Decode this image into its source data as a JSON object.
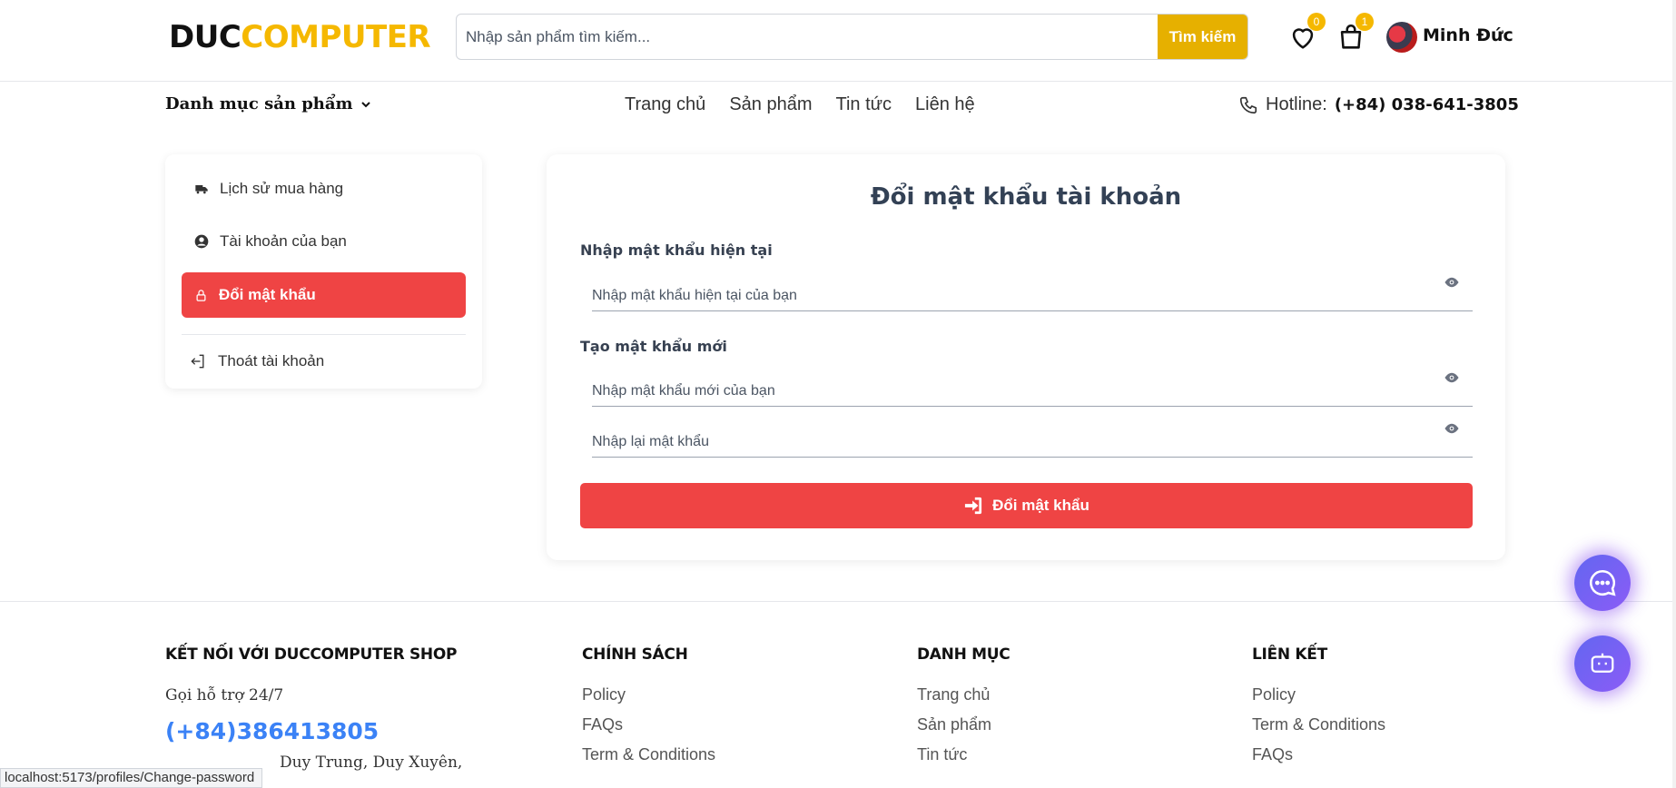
{
  "header": {
    "logo_part1": "DUC",
    "logo_part2": "COMPUTER",
    "search_placeholder": "Nhập sản phẩm tìm kiếm...",
    "search_button": "Tìm kiếm",
    "wishlist_count": "0",
    "cart_count": "1",
    "username": "Minh Đức"
  },
  "nav": {
    "category_menu": "Danh mục sản phẩm",
    "links": [
      "Trang chủ",
      "Sản phẩm",
      "Tin tức",
      "Liên hệ"
    ],
    "hotline_label": "Hotline:",
    "hotline_number": "(+84) 038-641-3805"
  },
  "sidebar": {
    "items": [
      {
        "label": "Lịch sử mua hàng",
        "icon": "truck-icon"
      },
      {
        "label": "Tài khoản của bạn",
        "icon": "user-circle-icon"
      },
      {
        "label": "Đổi mật khẩu",
        "icon": "lock-icon"
      },
      {
        "label": "Thoát tài khoản",
        "icon": "logout-icon"
      }
    ]
  },
  "form": {
    "title": "Đổi mật khẩu tài khoản",
    "current_label": "Nhập mật khẩu hiện tại",
    "current_placeholder": "Nhập mật khẩu hiện tại của bạn",
    "new_label": "Tạo mật khẩu mới",
    "new_placeholder": "Nhập mật khẩu mới của bạn",
    "confirm_placeholder": "Nhập lại mật khẩu",
    "submit_label": "Đổi mật khẩu"
  },
  "footer": {
    "connect_title": "KẾT NỐI VỚI DUCCOMPUTER SHOP",
    "support_text": "Gọi hỗ trợ 24/7",
    "phone": "(+84)386413805",
    "address": "Duy Trung, Duy Xuyên,",
    "policy_title": "CHÍNH SÁCH",
    "policy_links": [
      "Policy",
      "FAQs",
      "Term & Conditions"
    ],
    "category_title": "DANH MỤC",
    "category_links": [
      "Trang chủ",
      "Sản phẩm",
      "Tin tức"
    ],
    "links_title": "LIÊN KẾT",
    "links_links": [
      "Policy",
      "Term & Conditions",
      "FAQs"
    ]
  },
  "status_url": "localhost:5173/profiles/Change-password",
  "colors": {
    "accent_yellow": "#f5b800",
    "primary_red": "#ef4444",
    "phone_blue": "#3b82f6",
    "fab_purple": "#7c3aed"
  }
}
